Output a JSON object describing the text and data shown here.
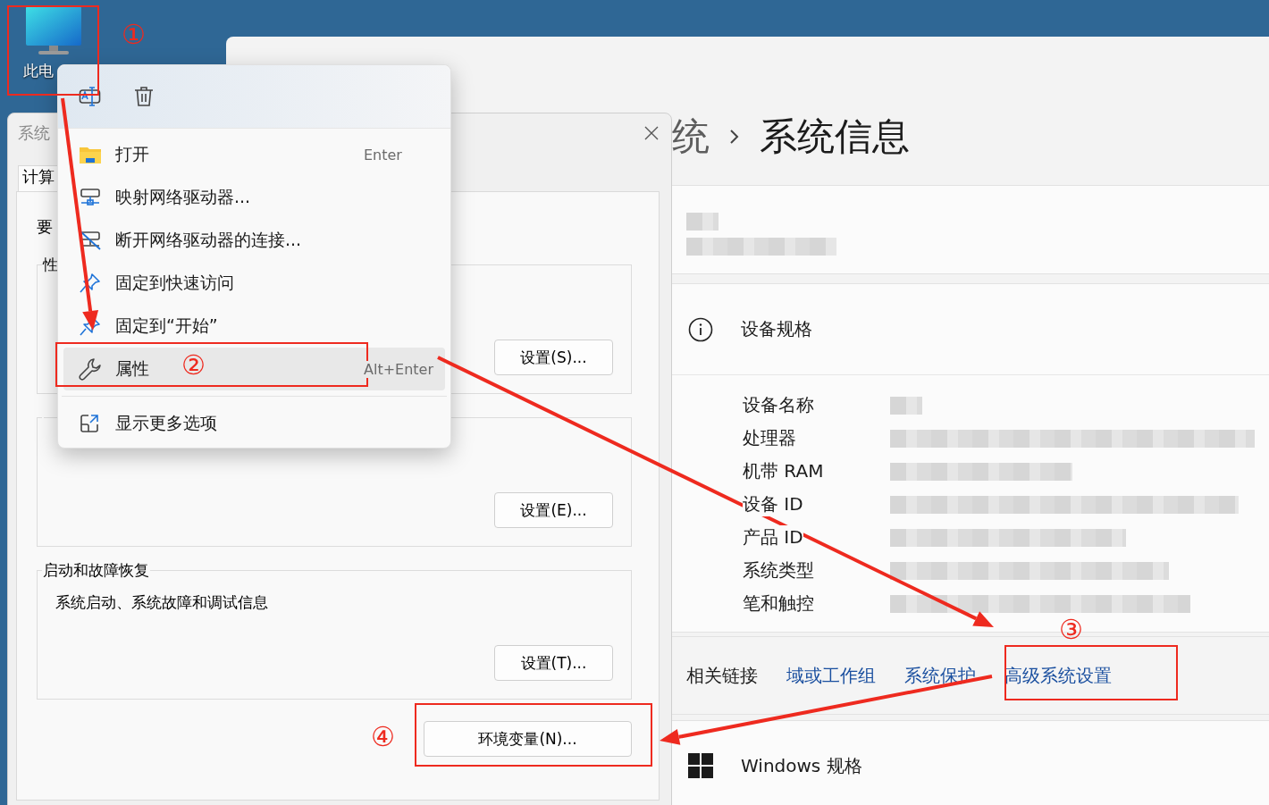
{
  "desktop_icon": {
    "label": "此电"
  },
  "settings": {
    "breadcrumb": {
      "parent": "统",
      "current": "系统信息"
    },
    "device_specs": {
      "title": "设备规格",
      "rows": [
        {
          "label": "设备名称"
        },
        {
          "label": "处理器"
        },
        {
          "label": "机带 RAM"
        },
        {
          "label": "设备 ID"
        },
        {
          "label": "产品 ID"
        },
        {
          "label": "系统类型"
        },
        {
          "label": "笔和触控"
        }
      ]
    },
    "related_links": {
      "label": "相关链接",
      "links": [
        "域或工作组",
        "系统保护",
        "高级系统设置"
      ]
    },
    "windows_spec": {
      "title": "Windows 规格"
    }
  },
  "dialog": {
    "title": "系统",
    "tabs": [
      {
        "label": "计算",
        "selected": true
      }
    ],
    "intro": "要",
    "groups": [
      {
        "legend": "性",
        "button": "设置(S)..."
      },
      {
        "button": "设置(E)..."
      },
      {
        "legend": "启动和故障恢复",
        "description": "系统启动、系统故障和调试信息",
        "button": "设置(T)..."
      }
    ],
    "env_button": "环境变量(N)..."
  },
  "context_menu": {
    "toolbar": [
      {
        "kind": "rename"
      },
      {
        "kind": "delete"
      }
    ],
    "items": [
      {
        "kind": "open",
        "label": "打开",
        "shortcut": "Enter",
        "selected": false
      },
      {
        "kind": "map-drive",
        "label": "映射网络驱动器...",
        "selected": false
      },
      {
        "kind": "disconnect",
        "label": "断开网络驱动器的连接...",
        "selected": false
      },
      {
        "kind": "pin",
        "label": "固定到快速访问",
        "selected": false
      },
      {
        "kind": "pin",
        "label": "固定到“开始”",
        "selected": false
      },
      {
        "kind": "properties",
        "label": "属性",
        "shortcut": "Alt+Enter",
        "selected": true
      }
    ],
    "footer_item": {
      "kind": "more",
      "label": "显示更多选项"
    }
  },
  "annotations": {
    "markers": [
      "①",
      "②",
      "③",
      "④"
    ]
  }
}
